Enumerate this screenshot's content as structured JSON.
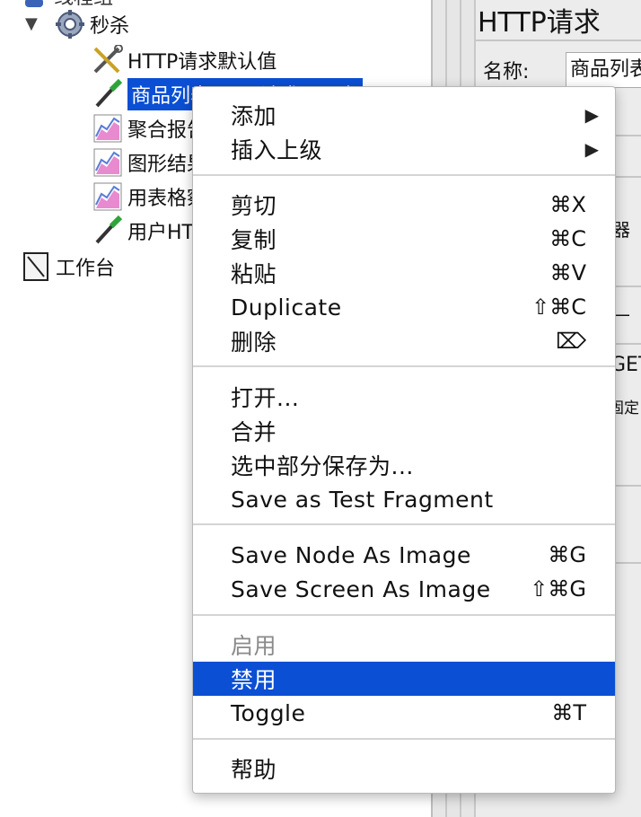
{
  "tree": {
    "top_partial_label": "线程组",
    "items": [
      {
        "label": "秒杀",
        "icon": "gear-icon"
      },
      {
        "label": "HTTP请求默认值",
        "icon": "wrench-icon"
      },
      {
        "label": "商品列表HTTP请求 - 无参",
        "icon": "pipette-icon"
      },
      {
        "label": "聚合报告",
        "icon": "graph-icon"
      },
      {
        "label": "图形结果",
        "icon": "graph-icon"
      },
      {
        "label": "用表格察看结果",
        "icon": "graph-icon"
      },
      {
        "label": "用户HTTP请求",
        "icon": "pipette-icon"
      },
      {
        "label": "工作台",
        "icon": "workbench-icon"
      }
    ]
  },
  "right_panel": {
    "title": "HTTP请求",
    "name_label": "名称:",
    "name_value": "商品列表",
    "fragments": {
      "器": "器",
      "get": "GET",
      "fixed": "固定",
      "dash": "—"
    }
  },
  "context_menu": {
    "items": [
      {
        "label": "添加",
        "submenu": true
      },
      {
        "label": "插入上级",
        "submenu": true
      },
      {
        "label": "剪切",
        "shortcut": "⌘X"
      },
      {
        "label": "复制",
        "shortcut": "⌘C"
      },
      {
        "label": "粘贴",
        "shortcut": "⌘V"
      },
      {
        "label": "Duplicate",
        "shortcut": "⇧⌘C"
      },
      {
        "label": "删除",
        "shortcut": "⌦"
      },
      {
        "label": "打开...",
        "shortcut": ""
      },
      {
        "label": "合并",
        "shortcut": ""
      },
      {
        "label": "选中部分保存为...",
        "shortcut": ""
      },
      {
        "label": "Save as Test Fragment",
        "shortcut": ""
      },
      {
        "label": "Save Node As Image",
        "shortcut": "⌘G"
      },
      {
        "label": "Save Screen As Image",
        "shortcut": "⇧⌘G"
      },
      {
        "label": "启用",
        "shortcut": "",
        "disabled": true
      },
      {
        "label": "禁用",
        "shortcut": "",
        "highlighted": true
      },
      {
        "label": "Toggle",
        "shortcut": "⌘T"
      },
      {
        "label": "帮助",
        "shortcut": ""
      }
    ],
    "submenu_arrow": "▶"
  },
  "colors": {
    "selection": "#0a4fd4",
    "menu_bg": "#ffffff",
    "panel_bg": "#ececec",
    "disabled_text": "#8a8a8a"
  }
}
